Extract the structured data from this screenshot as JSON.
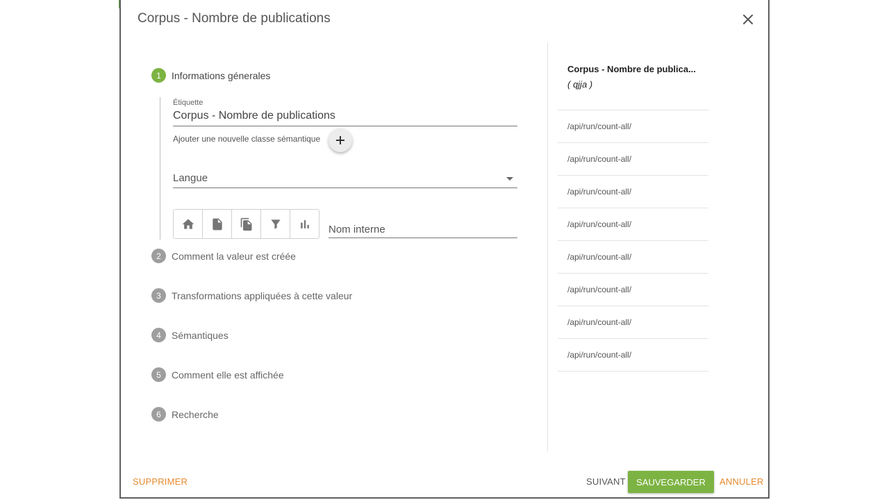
{
  "dialog": {
    "title": "Corpus - Nombre de publications"
  },
  "steps": [
    {
      "number": "1",
      "label": "Informations génerales",
      "active": true
    },
    {
      "number": "2",
      "label": "Comment la valeur est créée"
    },
    {
      "number": "3",
      "label": "Transformations appliquées à cette valeur"
    },
    {
      "number": "4",
      "label": "Sémantiques"
    },
    {
      "number": "5",
      "label": "Comment elle est affichée"
    },
    {
      "number": "6",
      "label": "Recherche"
    }
  ],
  "form": {
    "etiquette_label": "Étiquette",
    "etiquette_value": "Corpus - Nombre de publications",
    "semantic_label": "Ajouter une nouvelle classe sémantique",
    "langue_placeholder": "Langue",
    "nom_interne_placeholder": "Nom interne",
    "scope_icons": [
      "home-icon",
      "document-icon",
      "documents-icon",
      "filter-icon",
      "bar-chart-icon"
    ]
  },
  "right_panel": {
    "title": "Corpus - Nombre de publica...",
    "subtitle": "( qjja )",
    "items": [
      "/api/run/count-all/",
      "/api/run/count-all/",
      "/api/run/count-all/",
      "/api/run/count-all/",
      "/api/run/count-all/",
      "/api/run/count-all/",
      "/api/run/count-all/",
      "/api/run/count-all/"
    ]
  },
  "footer": {
    "delete_label": "SUPPRIMER",
    "next_label": "SUIVANT",
    "save_label": "SAUVEGARDER",
    "cancel_label": "ANNULER"
  },
  "colors": {
    "accent_green": "#7cb342",
    "accent_orange": "#e68a2e",
    "inactive_step": "#9e9e9e"
  }
}
